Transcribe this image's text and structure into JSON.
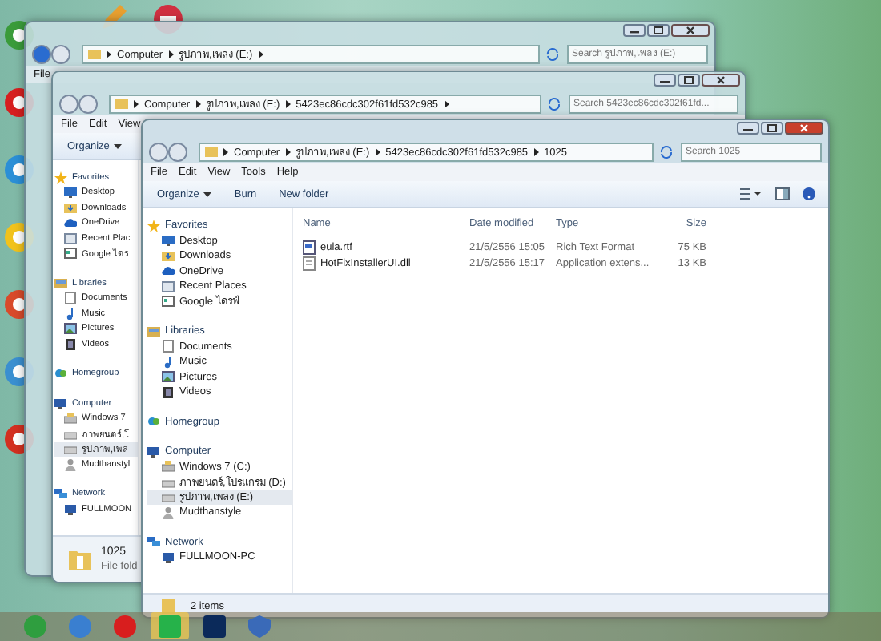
{
  "windows": [
    {
      "active": false,
      "crumbs": [
        "Computer",
        "รูปภาพ,เพลง (E:)"
      ],
      "search": {
        "placeholder": "Search รูปภาพ,เพลง (E:)"
      },
      "menu": [
        "File"
      ]
    },
    {
      "active": false,
      "crumbs": [
        "Computer",
        "รูปภาพ,เพลง (E:)",
        "5423ec86cdc302f61fd532c985"
      ],
      "search": {
        "placeholder": "Search 5423ec86cdc302f61fd..."
      },
      "menu": [
        "File",
        "Edit",
        "View"
      ],
      "toolbar": [
        {
          "label": "Organize",
          "dropdown": true
        }
      ],
      "nav": [
        {
          "label": "Favorites",
          "kind": "star",
          "selected": false,
          "children": [
            {
              "label": "Desktop",
              "kind": "desktop",
              "selected": false
            },
            {
              "label": "Downloads",
              "kind": "downloads",
              "selected": false
            },
            {
              "label": "OneDrive",
              "kind": "cloud",
              "selected": false
            },
            {
              "label": "Recent Plac",
              "kind": "recent",
              "selected": false
            },
            {
              "label": "Google ไดร",
              "kind": "web",
              "selected": false
            }
          ]
        },
        {
          "label": "Libraries",
          "kind": "library",
          "selected": false,
          "children": [
            {
              "label": "Documents",
              "kind": "doc",
              "selected": false
            },
            {
              "label": "Music",
              "kind": "music",
              "selected": false
            },
            {
              "label": "Pictures",
              "kind": "pictures",
              "selected": false
            },
            {
              "label": "Videos",
              "kind": "videos",
              "selected": false
            }
          ]
        },
        {
          "label": "Homegroup",
          "kind": "homegroup",
          "selected": false
        },
        {
          "label": "Computer",
          "kind": "computer",
          "selected": false,
          "children": [
            {
              "label": "Windows 7",
              "kind": "windrive",
              "selected": false
            },
            {
              "label": "ภาพยนตร์,โ",
              "kind": "drive",
              "selected": false
            },
            {
              "label": "รูปภาพ,เพล",
              "kind": "drive",
              "selected": true
            },
            {
              "label": "Mudthanstyl",
              "kind": "user",
              "selected": false
            }
          ]
        },
        {
          "label": "Network",
          "kind": "network",
          "selected": false,
          "children": [
            {
              "label": "FULLMOON",
              "kind": "pc",
              "selected": false
            }
          ]
        }
      ],
      "details": {
        "name": "1025",
        "type": "File fold"
      }
    },
    {
      "active": true,
      "crumbs": [
        "Computer",
        "รูปภาพ,เพลง (E:)",
        "5423ec86cdc302f61fd532c985",
        "1025"
      ],
      "search": {
        "placeholder": "Search 1025"
      },
      "menu": [
        "File",
        "Edit",
        "View",
        "Tools",
        "Help"
      ],
      "toolbar": [
        {
          "label": "Organize",
          "dropdown": true
        },
        {
          "label": "Burn",
          "dropdown": false
        },
        {
          "label": "New folder",
          "dropdown": false
        }
      ],
      "nav": [
        {
          "label": "Favorites",
          "kind": "star",
          "selected": false,
          "children": [
            {
              "label": "Desktop",
              "kind": "desktop",
              "selected": false
            },
            {
              "label": "Downloads",
              "kind": "downloads",
              "selected": false
            },
            {
              "label": "OneDrive",
              "kind": "cloud",
              "selected": false
            },
            {
              "label": "Recent Places",
              "kind": "recent",
              "selected": false
            },
            {
              "label": "Google ไดรฟ์",
              "kind": "web",
              "selected": false
            }
          ]
        },
        {
          "label": "Libraries",
          "kind": "library",
          "selected": false,
          "children": [
            {
              "label": "Documents",
              "kind": "doc",
              "selected": false
            },
            {
              "label": "Music",
              "kind": "music",
              "selected": false
            },
            {
              "label": "Pictures",
              "kind": "pictures",
              "selected": false
            },
            {
              "label": "Videos",
              "kind": "videos",
              "selected": false
            }
          ]
        },
        {
          "label": "Homegroup",
          "kind": "homegroup",
          "selected": false
        },
        {
          "label": "Computer",
          "kind": "computer",
          "selected": false,
          "children": [
            {
              "label": "Windows 7 (C:)",
              "kind": "windrive",
              "selected": false
            },
            {
              "label": "ภาพยนตร์,โปรแกรม (D:)",
              "kind": "drive",
              "selected": false
            },
            {
              "label": "รูปภาพ,เพลง (E:)",
              "kind": "drive",
              "selected": true
            },
            {
              "label": "Mudthanstyle",
              "kind": "user",
              "selected": false
            }
          ]
        },
        {
          "label": "Network",
          "kind": "network",
          "selected": false,
          "children": [
            {
              "label": "FULLMOON-PC",
              "kind": "pc",
              "selected": false
            }
          ]
        }
      ],
      "columns": [
        "Name",
        "Date modified",
        "Type",
        "Size"
      ],
      "rows": [
        {
          "kind": "rtf",
          "cells": [
            "eula.rtf",
            "21/5/2556 15:05",
            "Rich Text Format",
            "75 KB"
          ]
        },
        {
          "kind": "dll",
          "cells": [
            "HotFixInstallerUI.dll",
            "21/5/2556 15:17",
            "Application extens...",
            "13 KB"
          ]
        }
      ],
      "status": "2 items"
    }
  ],
  "taskbar": [
    {
      "selected": false
    },
    {
      "selected": false
    },
    {
      "selected": false
    },
    {
      "selected": true
    },
    {
      "selected": false
    },
    {
      "selected": false
    }
  ]
}
